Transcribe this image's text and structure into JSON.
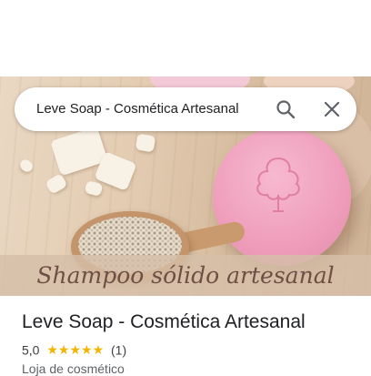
{
  "search": {
    "query": "Leve Soap - Cosmética Artesanal",
    "search_icon": "search-icon",
    "close_icon": "close-icon"
  },
  "hero": {
    "banner_text": "Shampoo sólido artesanal"
  },
  "place": {
    "name": "Leve Soap - Cosmética Artesanal",
    "rating": "5,0",
    "stars": "★★★★★",
    "review_count": "(1)",
    "category": "Loja de cosmético"
  },
  "colors": {
    "star": "#f5b400",
    "soap_pink": "#ef9fbc",
    "banner_text": "#6e4f44"
  }
}
